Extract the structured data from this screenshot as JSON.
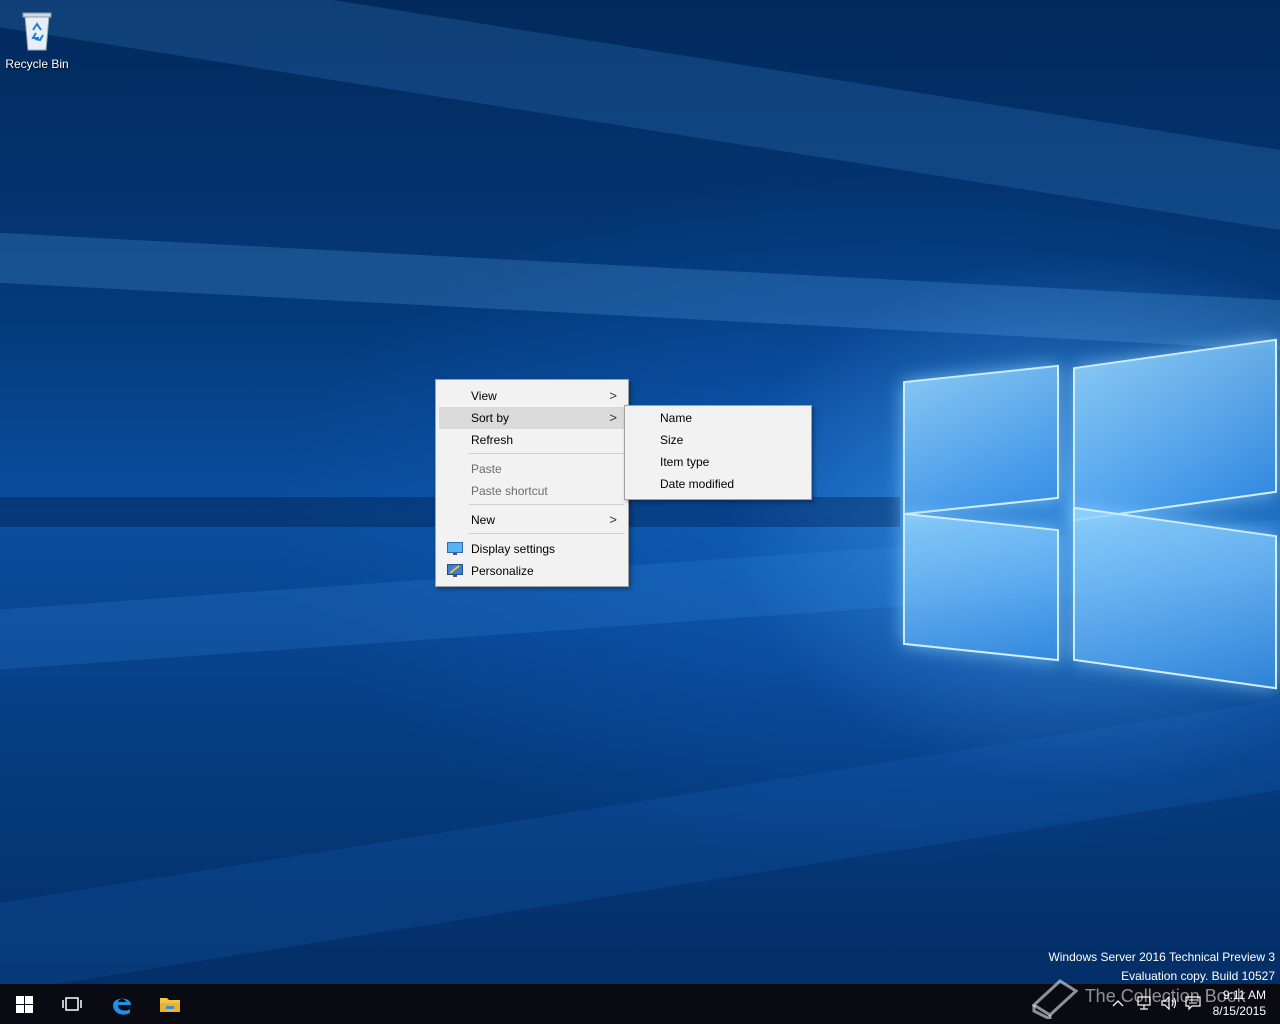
{
  "desktop": {
    "icons": [
      {
        "label": "Recycle Bin",
        "icon": "recycle-bin-icon"
      }
    ],
    "watermark": {
      "line1": "Windows Server 2016 Technical Preview 3",
      "line2": "Evaluation copy. Build 10527"
    },
    "overlay_text": "The Collection Book"
  },
  "context_menu": {
    "items": [
      {
        "label": "View",
        "has_submenu": true
      },
      {
        "label": "Sort by",
        "has_submenu": true,
        "highlighted": true
      },
      {
        "label": "Refresh"
      },
      {
        "label": "Paste",
        "disabled": true
      },
      {
        "label": "Paste shortcut",
        "disabled": true
      },
      {
        "label": "New",
        "has_submenu": true
      },
      {
        "label": "Display settings",
        "icon": "display-settings-icon"
      },
      {
        "label": "Personalize",
        "icon": "personalize-icon"
      }
    ],
    "submenu_arrow": ">"
  },
  "sort_submenu": {
    "items": [
      {
        "label": "Name"
      },
      {
        "label": "Size"
      },
      {
        "label": "Item type"
      },
      {
        "label": "Date modified"
      }
    ]
  },
  "taskbar": {
    "buttons": [
      "start-icon",
      "task-view-icon",
      "edge-icon",
      "file-explorer-icon"
    ],
    "tray_icons": [
      "chevron-up-icon",
      "network-icon",
      "volume-icon",
      "action-center-icon"
    ],
    "clock": {
      "time": "9:11 AM",
      "date": "8/15/2015"
    }
  },
  "colors": {
    "menu_bg": "#f2f2f2",
    "menu_highlight": "#dadada",
    "taskbar_bg": "#0a0a12",
    "desktop_blue": "#0a4f9e"
  }
}
